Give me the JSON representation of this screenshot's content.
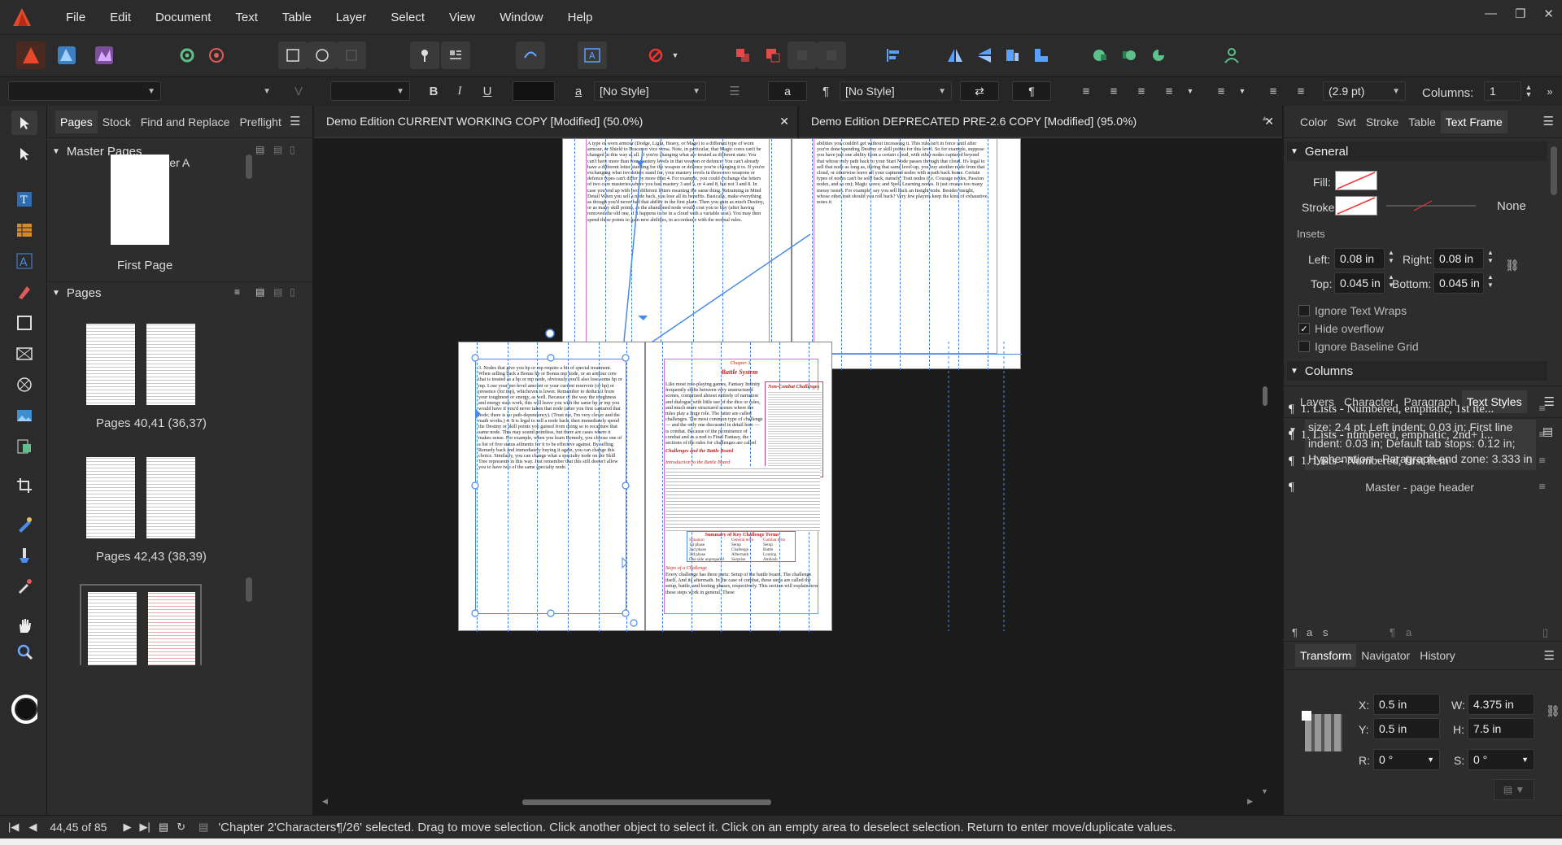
{
  "app": {
    "menus": [
      "File",
      "Edit",
      "Document",
      "Text",
      "Table",
      "Layer",
      "Select",
      "View",
      "Window",
      "Help"
    ],
    "accent": "#4a8ae8"
  },
  "context": {
    "font_family": "",
    "font_style": "",
    "font_size": "",
    "char_style": "[No Style]",
    "para_style": "[No Style]",
    "leading": "(2.9 pt)",
    "columns_label": "Columns:",
    "columns_value": "1"
  },
  "left_panel": {
    "tabs": [
      "Pages",
      "Stock",
      "Find and Replace",
      "Preflight"
    ],
    "master_section": "Master Pages",
    "master_name": "Master A",
    "master_caption": "First Page",
    "pages_section": "Pages",
    "spreads": [
      {
        "label": "Pages 40,41 (36,37)"
      },
      {
        "label": "Pages 42,43 (38,39)"
      },
      {
        "label": ""
      }
    ]
  },
  "documents": [
    {
      "title": "Demo Edition CURRENT WORKING COPY [Modified] (50.0%)"
    },
    {
      "title": "Demo Edition DEPRECATED PRE-2.6 COPY [Modified] (95.0%)"
    }
  ],
  "page_text": {
    "chapter": "Chapter 3",
    "chapter_title": "Battle System",
    "heading1": "Challenges and the Battle Board",
    "heading2": "Introduction to the Battle Board",
    "sidebar_title": "Non-Combat Challenges",
    "table_title": "Summary of Key Challenge Terms",
    "table_headers": [
      "Situation",
      "General term",
      "Combat term"
    ],
    "table_rows": [
      [
        "1st phase",
        "Setup",
        "Setup"
      ],
      [
        "2nd phase",
        "Challenge",
        "Battle"
      ],
      [
        "3rd phase",
        "Aftermath",
        "Looting"
      ],
      [
        "One side unprepared",
        "Surprise",
        "Ambush"
      ]
    ],
    "steps_heading": "Steps of a Challenge",
    "col_left": "3. Nodes that give you hp or mp require a bit of special treatment. When selling back a Bonus hp or Bonus mp node, or an armour core that is treated as a hp or mp node, obviously you'll also lose some hp or mp. Lose your per-level amount or your current reservoir (or hp) or presence (for mp), whichever is lower. Remember to deduct it from your toughness or energy, as well. Because of the way the toughness and energy stats work, this will leave you with the same hp or mp you would have if you'd never taken that node (after you first captured that node; there is no path-dependency). (Trust me, I'm very clever and the math works.) 4. It is legal to sell a node back, then immediately spend the Destiny or skill points you gained from doing so to recapture that same node. This may sound pointless, but there are cases where it makes sense. For example, when you learn Remedy, you choose one of a list of five status ailments for it to be effective against. By selling Remedy back and immediately buying it again, you can change this choice. Similarly, you can change what a specialty node on the Skill Tree represents in this way. Just remember that this still doesn't allow you to have two of the same specialty node.",
    "col_right": "Like most role-playing games, Fantasy Infinity frequently shifts between very unstructured scenes, comprised almost entirely of narration and dialogue with little use of the dice or rules, and much more structured scenes where the rules play a large role. The latter are called challenges. The most common type of challenge — and the only one discussed in detail here — is combat. Because of the prominence of combat and as a nod to Final Fantasy, the sections of the rules for challenges are called the Battle System. Challenges use the Battle Board. The Battle Board has two main parts — the initiative track along the outside, resembling the scoring track found in many board games, and the battlefield in the center, a staggered grid of rectangular spaces. The initiative track is used to determine who gets to take actions when. This is explained in more detail below. The battlefield is used to show where the participants are in relation to one another, but it does this very abstractly.",
    "steps_text": "Every challenge has three parts: Setup of the battle board, The challenge itself, And its aftermath. In the case of combat, these steps are called the setup, battle, and looting phases, respectively. This section will explain how these steps work in general. These",
    "top_left_text": "A type of worn armour (Dodge, Light, Heavy, or Mage) to a different type of worn armour, or Shield to Bracer or vice versa. Note, in particular, that Magic cores can't be changed in this way at all. If you're changing what are treated as different stats: You can't have more than four mastery levels in that weapon or defence. You can't already have a different letter standing for the weapon or defence you're changing it to. If you're exchanging what two letters stand for, your mastery levels in those two weapons or defence types can't differ by more than 4. For example, you could exchange the letters of two core masteries where you had mastery 3 and 5, or 4 and 8, but not 3 and 8. In case you end up with two different letters meaning the same thing. Retraining in Mind Detail When you sell a node back, you lose all its benefits. Basically, make everything as though you'd never had that ability in the first place. Then you gain as much Destiny, or as many skill points, as the abandoned node would cost you to buy (after having removed the old one, if it happens to be in a cloud with a variable cost). You may then spend these points to gain new abilities, in accordance with the normal rules.",
    "top_right_text": "abilities you couldn't get without increasing it. This rule isn't in force until after you're done spending Destiny or skill points for this level. So for example, suppose you have just one ability from a certain cloud, with other nodes captured beyond that whose only path back to your Start Node passes through that cloud. It's legal to sell that node as long as, during that same level-up, you buy another node from that cloud, or otherwise leave all your captured nodes with a path back home. Certain types of nodes can't be sold back, namely: Trait nodes (i.e. Courage nodes, Passion nodes, and so on); Magic cores; and Spell Learning nodes. It just creates too many messy issues. For example, say you sell back an Insight node. Besides insight, whose other trait should you roll back? Very few players keep the kind of exhaustive notes it"
  },
  "text_frame": {
    "tabs": [
      "Color",
      "Swt",
      "Stroke",
      "Table",
      "Text Frame"
    ],
    "general": "General",
    "fill_label": "Fill:",
    "stroke_label": "Stroke:",
    "stroke_none": "None",
    "insets_label": "Insets",
    "left_label": "Left:",
    "left": "0.08 in",
    "right_label": "Right:",
    "right": "0.08 in",
    "top_label": "Top:",
    "top": "0.045 in",
    "bottom_label": "Bottom:",
    "bottom": "0.045 in",
    "opt1": "Ignore Text Wraps",
    "opt2": "Hide overflow",
    "opt3": "Ignore Baseline Grid",
    "columns": "Columns"
  },
  "styles_panel": {
    "tabs": [
      "Layers",
      "Character",
      "Paragraph",
      "Text Styles"
    ],
    "desc": "size: 2.4 pt; Left indent: 0.03 in; First line indent: 0.03 in; Default tab stops: 0.12 in; Hyphenation - Paragraph end zone: 3.333 in",
    "items": [
      "1. Lists - Numbered, emphatic, 1st ite...",
      "1. Lists - numbered, emphatic, 2nd+ i...",
      "1. Lists - Numbered, first item",
      "Master - page header"
    ]
  },
  "transform": {
    "tabs": [
      "Transform",
      "Navigator",
      "History"
    ],
    "x_label": "X:",
    "x": "0.5 in",
    "y_label": "Y:",
    "y": "0.5 in",
    "w_label": "W:",
    "w": "4.375 in",
    "h_label": "H:",
    "h": "7.5 in",
    "r_label": "R:",
    "r": "0 °",
    "s_label": "S:",
    "s": "0 °"
  },
  "status": {
    "page": "44,45 of 85",
    "message": "'Chapter 2'Characters¶/26' selected. Drag to move selection. Click another object to select it. Click on an empty area to deselect selection. Return to enter move/duplicate values."
  }
}
